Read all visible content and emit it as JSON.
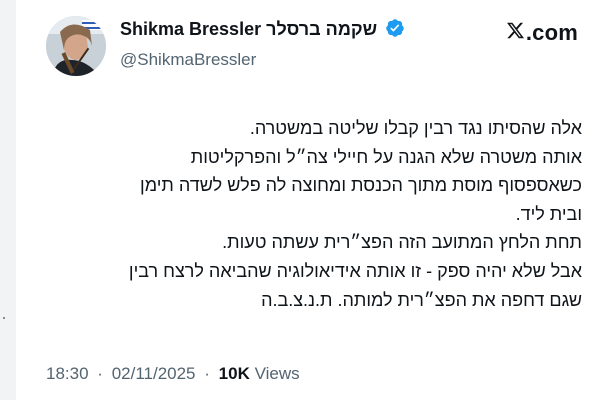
{
  "header": {
    "display_name": "Shikma Bressler שקמה ברסלר",
    "handle": "@ShikmaBressler",
    "brand": "X.com",
    "brand_suffix": ".com",
    "verified_color": "#1d9bf0"
  },
  "tweet": {
    "lines": [
      "אלה שהסיתו נגד רבין קבלו שליטה במשטרה.",
      "אותה משטרה שלא הגנה על חיילי צה״ל והפרקליטות",
      "כשאספסוף מוסת מתוך הכנסת ומחוצה לה פלש לשדה תימן",
      "ובית ליד.",
      "תחת הלחץ המתועב הזה הפצ״רית עשתה טעות.",
      "אבל שלא יהיה ספק - זו אותה אידיאולוגיה שהביאה לרצח רבין",
      "שגם דחפה את הפצ״רית למותה. ת.נ.צ.ב.ה"
    ]
  },
  "meta": {
    "time": "18:30",
    "separator": "·",
    "date": "02/11/2025",
    "views_count": "10K",
    "views_label": "Views"
  },
  "colors": {
    "text": "#0f1419",
    "secondary": "#536471",
    "background": "#ffffff"
  },
  "icons": {
    "verified": "verified-badge-icon",
    "brand": "x-logo-icon"
  }
}
